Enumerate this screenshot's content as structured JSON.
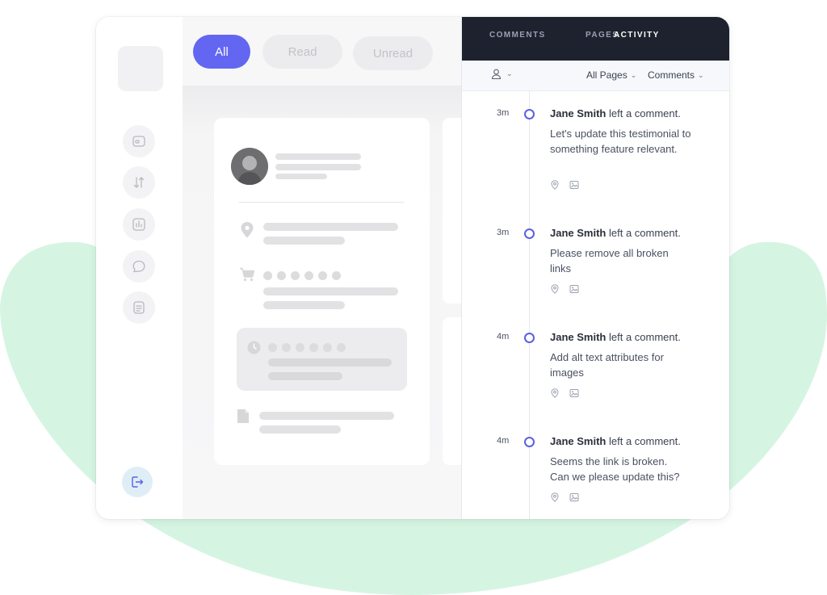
{
  "filters": {
    "all": "All",
    "read": "Read",
    "unread": "Unread"
  },
  "panel": {
    "tabs": [
      "COMMENTS",
      "PAGES",
      "ACTIVITY"
    ],
    "active_tab": "ACTIVITY",
    "pages_filter": "All Pages",
    "type_filter": "Comments"
  },
  "entries": [
    {
      "time": "3m",
      "author": "Jane Smith",
      "action": "left a comment.",
      "message": "Let's update this testimonial to something feature relevant."
    },
    {
      "time": "3m",
      "author": "Jane Smith",
      "action": "left a comment.",
      "message": "Please remove all broken links"
    },
    {
      "time": "4m",
      "author": "Jane Smith",
      "action": "left a comment.",
      "message": "Add alt text attributes for images"
    },
    {
      "time": "4m",
      "author": "Jane Smith",
      "action": "left a comment.",
      "message": "Seems the link is broken. Can we please update this?"
    }
  ],
  "colors": {
    "accent": "#6366f1",
    "panel_header": "#1d222e",
    "background_blob": "#d5f5e2"
  },
  "icons": {
    "sidebar": [
      "wallet-icon",
      "transfer-icon",
      "chart-icon",
      "chat-bubble-icon",
      "document-icon"
    ],
    "logout": "logout-icon",
    "entry": [
      "location-pin-icon",
      "image-icon"
    ]
  }
}
